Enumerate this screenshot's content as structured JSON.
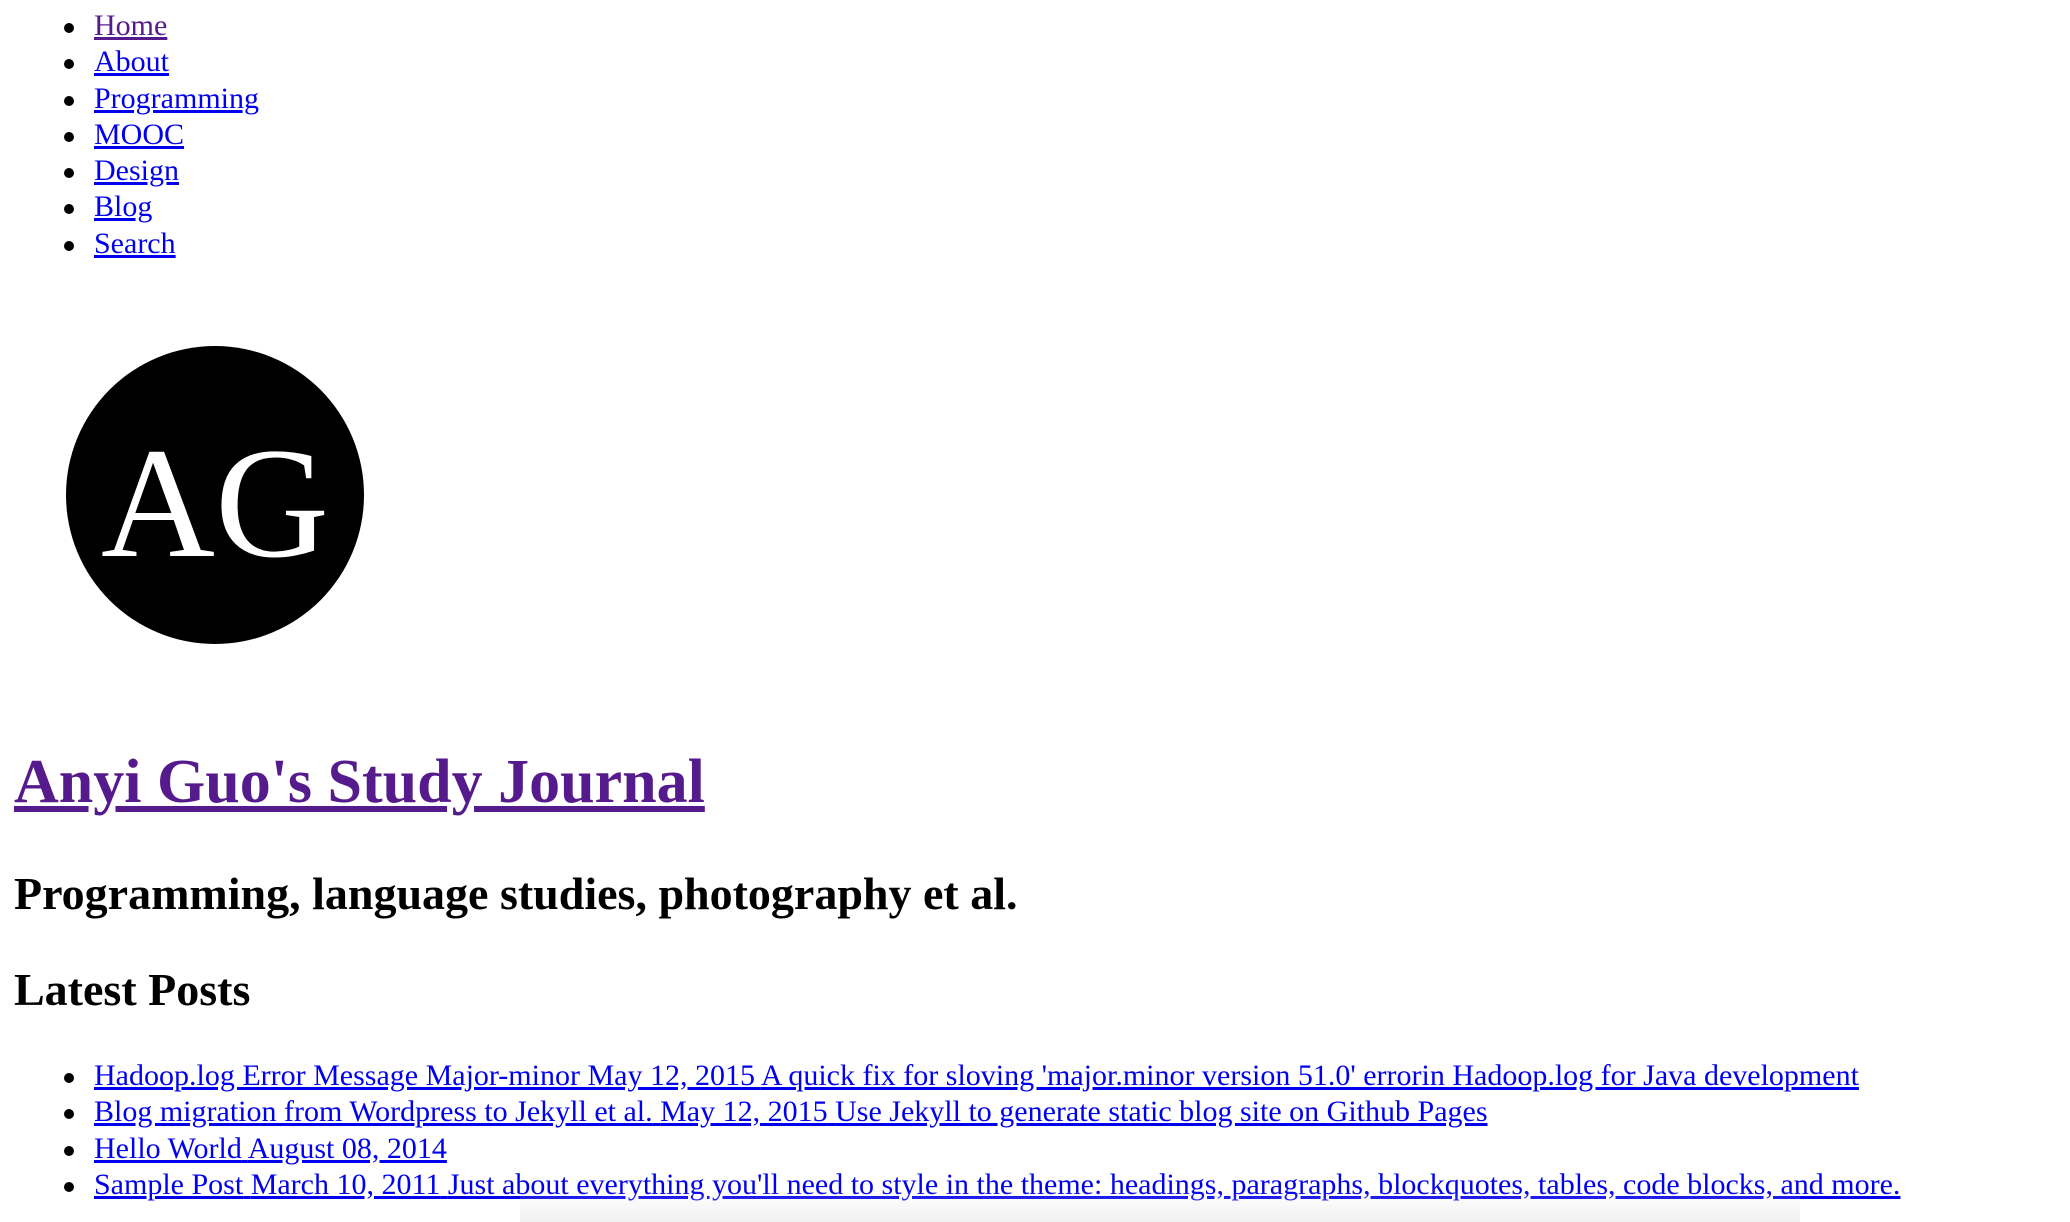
{
  "nav": {
    "items": [
      {
        "label": "Home",
        "visited": true
      },
      {
        "label": "About",
        "visited": false
      },
      {
        "label": "Programming",
        "visited": false
      },
      {
        "label": "MOOC",
        "visited": false
      },
      {
        "label": "Design",
        "visited": false
      },
      {
        "label": "Blog",
        "visited": false
      },
      {
        "label": "Search",
        "visited": false
      }
    ]
  },
  "logo": {
    "text": "AG",
    "background": "#000000",
    "foreground": "#ffffff"
  },
  "header": {
    "title": "Anyi Guo's Study Journal",
    "tagline": "Programming, language studies, photography et al."
  },
  "latest": {
    "heading": "Latest Posts",
    "posts": [
      {
        "title": "Hadoop.log Error Message Major-minor",
        "date": "May 12, 2015",
        "excerpt": "A quick fix for sloving 'major.minor version 51.0' errorin Hadoop.log for Java development"
      },
      {
        "title": "Blog migration from Wordpress to Jekyll et al.",
        "date": "May 12, 2015",
        "excerpt": "Use Jekyll to generate static blog site on Github Pages"
      },
      {
        "title": "Hello World",
        "date": "August 08, 2014",
        "excerpt": ""
      },
      {
        "title": "Sample Post",
        "date": "March 10, 2011",
        "excerpt": "Just about everything you'll need to style in the theme: headings, paragraphs, blockquotes, tables, code blocks, and more."
      }
    ]
  },
  "colors": {
    "link": "#0000ee",
    "visited_link": "#551a8b",
    "text": "#000000",
    "background": "#ffffff"
  }
}
